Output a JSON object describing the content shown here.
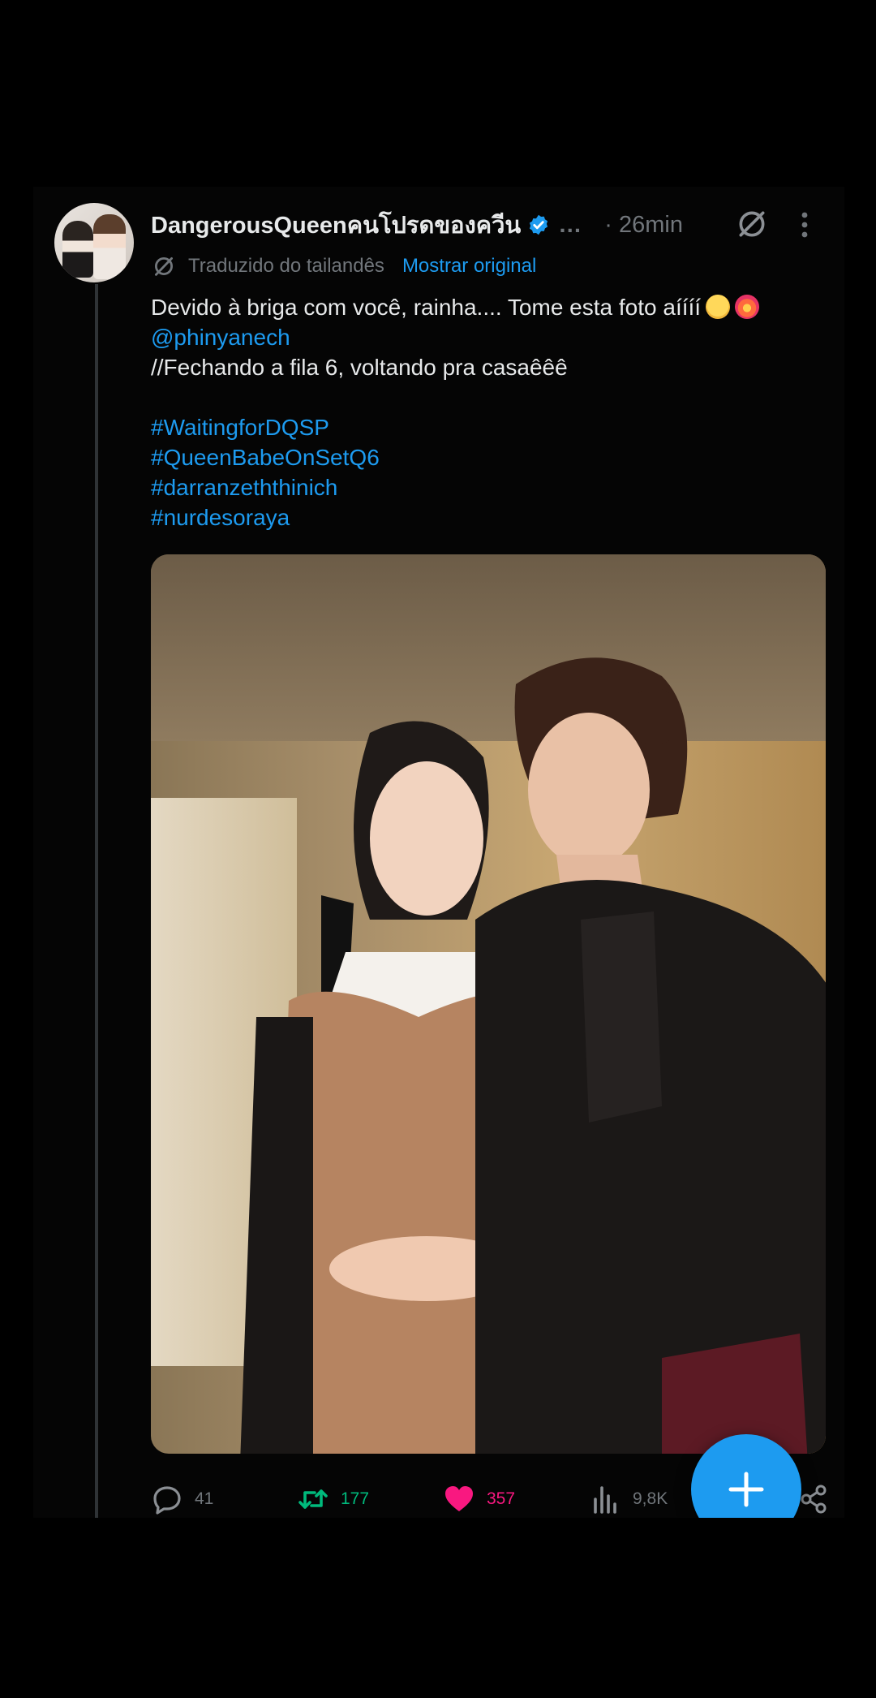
{
  "tweet": {
    "display_name": "DangerousQueenคนโปรดของควีน",
    "truncation": "…",
    "time_separator": "·",
    "time": "26min",
    "translation_label": "Traduzido do tailandês",
    "show_original": "Mostrar original",
    "text_lines": [
      "Devido à briga com você, rainha.... Tome esta foto aíííí"
    ],
    "mention": "@phinyanech",
    "second_line": "//Fechando a fila 6, voltando pra casaêêê",
    "hashtags": [
      "#WaitingforDQSP",
      "#QueenBabeOnSetQ6",
      "#darranzeththinich",
      "#nurdesoraya"
    ]
  },
  "actions": {
    "replies": "41",
    "retweets": "177",
    "likes": "357",
    "views": "9,8K"
  },
  "colors": {
    "accent": "#1d9bf0",
    "retweet": "#00ba7c",
    "like": "#f91880",
    "muted": "#71767b"
  },
  "icons": [
    "verified-badge-icon",
    "grok-icon",
    "more-icon",
    "translate-icon",
    "reply-icon",
    "retweet-icon",
    "heart-icon",
    "views-icon",
    "share-icon",
    "plus-icon"
  ]
}
